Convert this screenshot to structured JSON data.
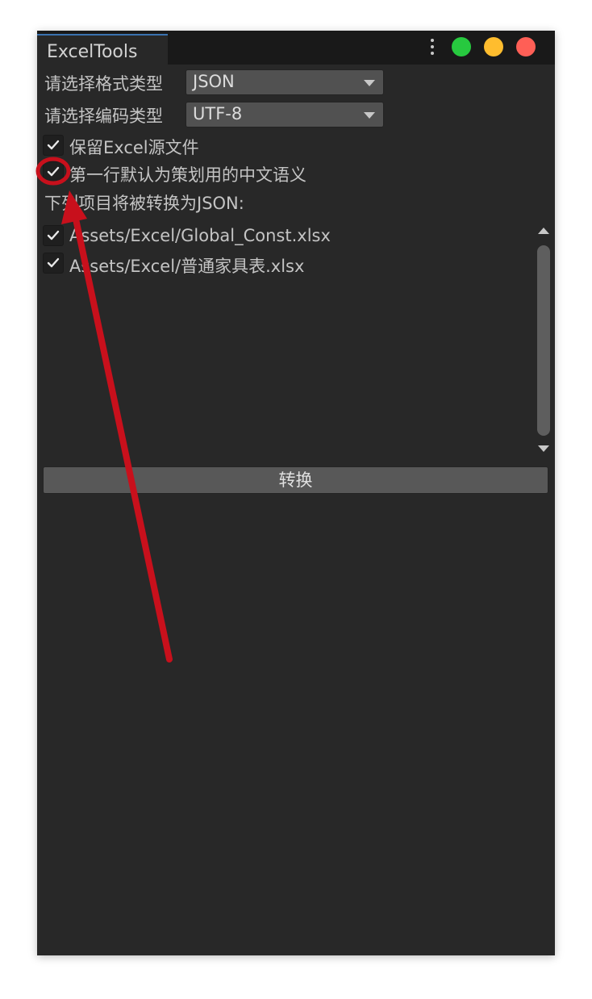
{
  "window": {
    "tab_title": "ExcelTools"
  },
  "traffic_lights": {
    "green": "#27c93f",
    "yellow": "#ffbd2e",
    "red": "#ff5f56"
  },
  "form": {
    "format_label": "请选择格式类型",
    "format_value": "JSON",
    "encoding_label": "请选择编码类型",
    "encoding_value": "UTF-8",
    "keep_source_label": "保留Excel源文件",
    "keep_source_checked": true,
    "first_row_label": "第一行默认为策划用的中文语义",
    "first_row_checked": true,
    "list_header": "下列项目将被转换为JSON:"
  },
  "files": [
    {
      "path": "Assets/Excel/Global_Const.xlsx",
      "checked": true
    },
    {
      "path": "Assets/Excel/普通家具表.xlsx",
      "checked": true
    }
  ],
  "actions": {
    "convert_label": "转换"
  },
  "annotation": {
    "color": "#c8101c"
  }
}
